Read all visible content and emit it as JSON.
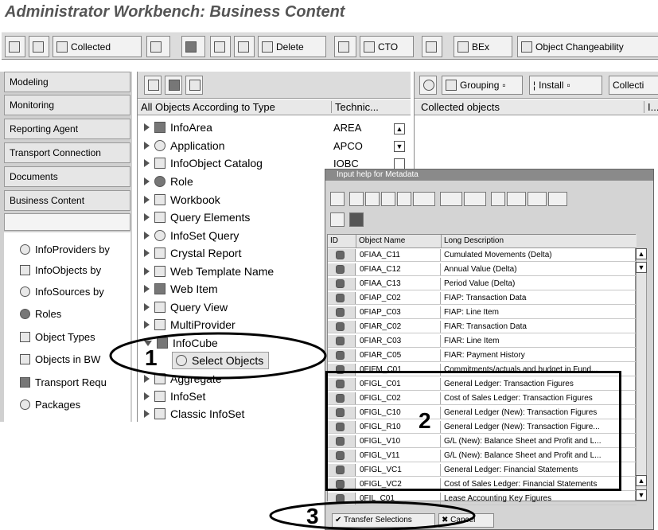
{
  "title": "Administrator Workbench: Business Content",
  "toolbar": {
    "collected": "Collected",
    "delete": "Delete",
    "cto": "CTO",
    "bex": "BEx",
    "object_changeability": "Object Changeability"
  },
  "nav": {
    "buttons": [
      "Modeling",
      "Monitoring",
      "Reporting Agent",
      "Transport Connection",
      "Documents",
      "Business Content"
    ],
    "items": [
      "InfoProviders by",
      "InfoObjects by",
      "InfoSources by",
      "Roles",
      "Object Types",
      "Objects in BW",
      "Transport Requ",
      "Packages"
    ]
  },
  "tree": {
    "col_objects": "All Objects According to Type",
    "col_tech": "Technic...",
    "items": [
      {
        "label": "InfoArea",
        "tech": "AREA"
      },
      {
        "label": "Application",
        "tech": "APCO"
      },
      {
        "label": "InfoObject Catalog",
        "tech": "IOBC"
      },
      {
        "label": "Role",
        "tech": ""
      },
      {
        "label": "Workbook",
        "tech": ""
      },
      {
        "label": "Query Elements",
        "tech": ""
      },
      {
        "label": "InfoSet Query",
        "tech": ""
      },
      {
        "label": "Crystal Report",
        "tech": ""
      },
      {
        "label": "Web Template Name",
        "tech": ""
      },
      {
        "label": "Web Item",
        "tech": ""
      },
      {
        "label": "Query View",
        "tech": ""
      },
      {
        "label": "MultiProvider",
        "tech": ""
      },
      {
        "label": "InfoCube",
        "tech": ""
      },
      {
        "label": "Select Objects",
        "tech": ""
      },
      {
        "label": "Aggregate",
        "tech": ""
      },
      {
        "label": "InfoSet",
        "tech": ""
      },
      {
        "label": "Classic InfoSet",
        "tech": ""
      }
    ]
  },
  "right": {
    "grouping": "Grouping",
    "install": "Install",
    "collection": "Collecti",
    "col_collected": "Collected objects",
    "col_i": "I..."
  },
  "dialog": {
    "title": "Input help for Metadata",
    "col_id": "ID",
    "col_name": "Object Name",
    "col_desc": "Long Description",
    "rows": [
      {
        "name": "0FIAA_C11",
        "desc": "Cumulated Movements (Delta)"
      },
      {
        "name": "0FIAA_C12",
        "desc": "Annual Value (Delta)"
      },
      {
        "name": "0FIAA_C13",
        "desc": "Period Value (Delta)"
      },
      {
        "name": "0FIAP_C02",
        "desc": "FIAP: Transaction Data"
      },
      {
        "name": "0FIAP_C03",
        "desc": "FIAP: Line Item"
      },
      {
        "name": "0FIAR_C02",
        "desc": "FIAR: Transaction Data"
      },
      {
        "name": "0FIAR_C03",
        "desc": "FIAR: Line Item"
      },
      {
        "name": "0FIAR_C05",
        "desc": "FIAR: Payment History"
      },
      {
        "name": "0FIFM_C01",
        "desc": "Commitments/actuals and budget in Fund..."
      },
      {
        "name": "0FIGL_C01",
        "desc": "General Ledger: Transaction Figures"
      },
      {
        "name": "0FIGL_C02",
        "desc": "Cost of Sales Ledger: Transaction Figures"
      },
      {
        "name": "0FIGL_C10",
        "desc": "General Ledger (New): Transaction Figures"
      },
      {
        "name": "0FIGL_R10",
        "desc": "General Ledger (New): Transaction Figure..."
      },
      {
        "name": "0FIGL_V10",
        "desc": "G/L (New): Balance Sheet and Profit and L..."
      },
      {
        "name": "0FIGL_V11",
        "desc": "G/L (New): Balance Sheet and Profit and L..."
      },
      {
        "name": "0FIGL_VC1",
        "desc": "General Ledger: Financial Statements"
      },
      {
        "name": "0FIGL_VC2",
        "desc": "Cost of Sales Ledger: Financial Statements"
      },
      {
        "name": "0FIL_C01",
        "desc": "Lease Accounting Key Figures"
      }
    ],
    "transfer": "Transfer Selections",
    "cancel": "Cancel"
  },
  "annotations": {
    "one": "1",
    "two": "2",
    "three": "3"
  }
}
